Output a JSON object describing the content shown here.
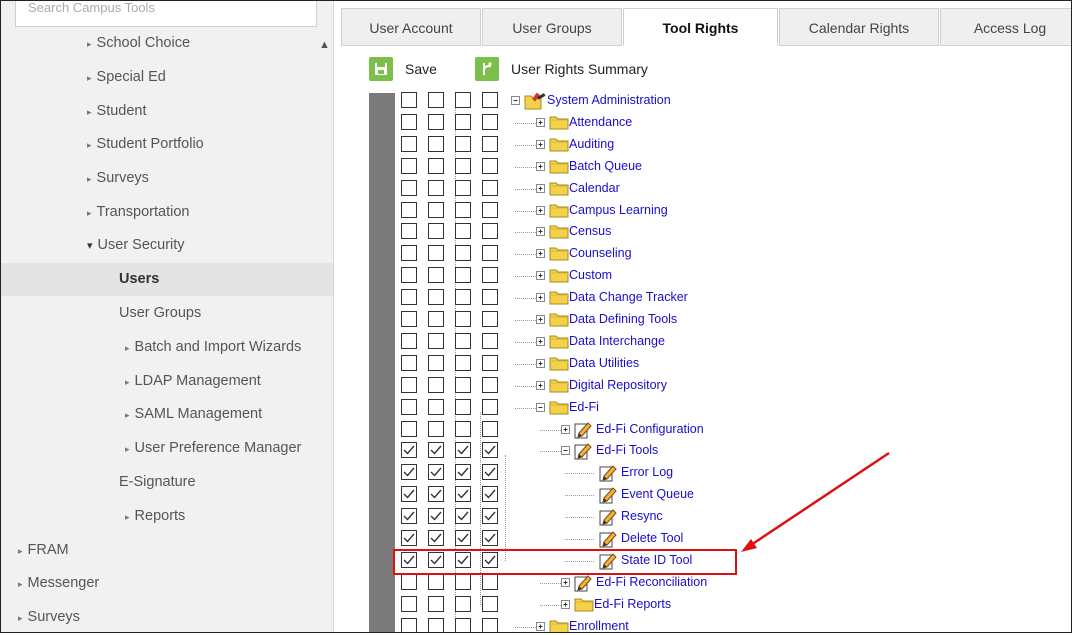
{
  "sidebar": {
    "search_placeholder": "Search Campus Tools",
    "items": [
      {
        "label": "School Choice",
        "marker": "▸"
      },
      {
        "label": "Special Ed",
        "marker": "▸"
      },
      {
        "label": "Student",
        "marker": "▸"
      },
      {
        "label": "Student Portfolio",
        "marker": "▸"
      },
      {
        "label": "Surveys",
        "marker": "▸"
      },
      {
        "label": "Transportation",
        "marker": "▸"
      },
      {
        "label": "User Security",
        "marker": "▾"
      },
      {
        "label": "Users",
        "marker": ""
      },
      {
        "label": "User Groups",
        "marker": ""
      },
      {
        "label": "Batch and Import Wizards",
        "marker": "▸"
      },
      {
        "label": "LDAP Management",
        "marker": "▸"
      },
      {
        "label": "SAML Management",
        "marker": "▸"
      },
      {
        "label": "User Preference Manager",
        "marker": "▸"
      },
      {
        "label": "E-Signature",
        "marker": ""
      },
      {
        "label": "Reports",
        "marker": "▸"
      },
      {
        "label": "FRAM",
        "marker": "▸"
      },
      {
        "label": "Messenger",
        "marker": "▸"
      },
      {
        "label": "Surveys",
        "marker": "▸"
      }
    ]
  },
  "tabs": [
    {
      "label": "User Account"
    },
    {
      "label": "User Groups"
    },
    {
      "label": "Tool Rights"
    },
    {
      "label": "Calendar Rights"
    },
    {
      "label": "Access Log"
    }
  ],
  "toolbar": {
    "save_label": "Save",
    "summary_label": "User Rights Summary"
  },
  "tree": [
    {
      "label": "System Administration",
      "checked": false
    },
    {
      "label": "Attendance",
      "checked": false
    },
    {
      "label": "Auditing",
      "checked": false
    },
    {
      "label": "Batch Queue",
      "checked": false
    },
    {
      "label": "Calendar",
      "checked": false
    },
    {
      "label": "Campus Learning",
      "checked": false
    },
    {
      "label": "Census",
      "checked": false
    },
    {
      "label": "Counseling",
      "checked": false
    },
    {
      "label": "Custom",
      "checked": false
    },
    {
      "label": "Data Change Tracker",
      "checked": false
    },
    {
      "label": "Data Defining Tools",
      "checked": false
    },
    {
      "label": "Data Interchange",
      "checked": false
    },
    {
      "label": "Data Utilities",
      "checked": false
    },
    {
      "label": "Digital Repository",
      "checked": false
    },
    {
      "label": "Ed-Fi",
      "checked": false
    },
    {
      "label": "Ed-Fi Configuration",
      "checked": false
    },
    {
      "label": "Ed-Fi Tools",
      "checked": true
    },
    {
      "label": "Error Log",
      "checked": true
    },
    {
      "label": "Event Queue",
      "checked": true
    },
    {
      "label": "Resync",
      "checked": true
    },
    {
      "label": "Delete Tool",
      "checked": true
    },
    {
      "label": "State ID Tool",
      "checked": true
    },
    {
      "label": "Ed-Fi Reconciliation",
      "checked": false
    },
    {
      "label": "Ed-Fi Reports",
      "checked": false
    },
    {
      "label": "Enrollment",
      "checked": false
    }
  ],
  "colors": {
    "highlight": "#e01010",
    "link": "#1a0dcc",
    "icon_green": "#7cc04b"
  }
}
